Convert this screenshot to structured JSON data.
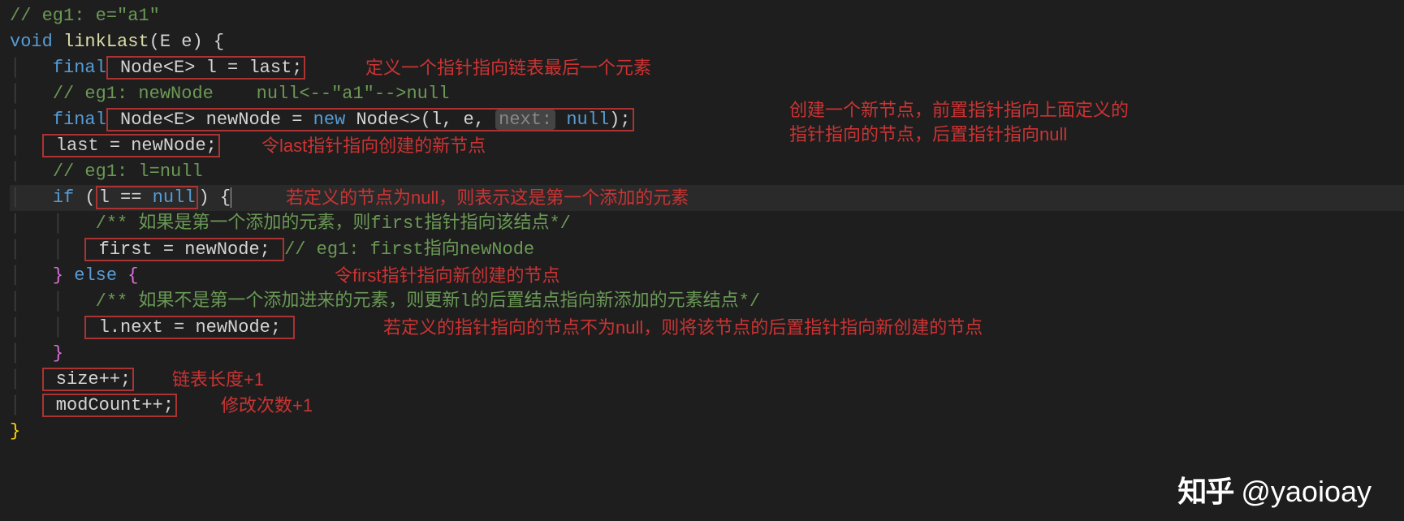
{
  "code": {
    "line1_comment": "// eg1: e=\"a1\"",
    "line2": {
      "kw_void": "void",
      "method": "linkLast",
      "params": "(E e) {"
    },
    "line3": {
      "indent": "    ",
      "kw_final": "final",
      "boxed": " Node<E> l = last;"
    },
    "line4_comment": "// eg1: newNode    null<--\"a1\"-->null",
    "line5": {
      "kw_final": "final",
      "boxed_prefix": " Node<E> newNode = ",
      "kw_new": "new",
      "rest": " Node<>(l, e, ",
      "hint": "next:",
      "null": " null",
      "close": ");"
    },
    "line6_boxed": " last = newNode;",
    "line7_comment": "// eg1: l=null",
    "line8": {
      "kw_if": "if",
      "open": " (",
      "cond_boxed": "l == ",
      "null": "null",
      "close": ") {"
    },
    "line9_doccomment": "/** 如果是第一个添加的元素，则first指针指向该结点*/",
    "line10_boxed": " first = newNode; ",
    "line10_comment": "// eg1: first指向newNode",
    "line11": {
      "close_brace": "}",
      "kw_else": " else ",
      "open_brace": "{"
    },
    "line12_doccomment": "/** 如果不是第一个添加进来的元素，则更新l的后置结点指向新添加的元素结点*/",
    "line13_boxed": " l.next = newNode; ",
    "line14_close": "}",
    "line15_boxed": " size++;",
    "line16_boxed": " modCount++;",
    "line17_close": "}"
  },
  "annotations": {
    "a1": "定义一个指针指向链表最后一个元素",
    "a2_line1": "创建一个新节点，前置指针指向上面定义的",
    "a2_line2": "指针指向的节点，后置指针指向null",
    "a3": "令last指针指向创建的新节点",
    "a4": "若定义的节点为null，则表示这是第一个添加的元素",
    "a5": "令first指针指向新创建的节点",
    "a6": "若定义的指针指向的节点不为null，则将该节点的后置指针指向新创建的节点",
    "a7": "链表长度+1",
    "a8": "修改次数+1"
  },
  "watermark": {
    "logo": "知乎",
    "handle": "@yaoioay"
  }
}
